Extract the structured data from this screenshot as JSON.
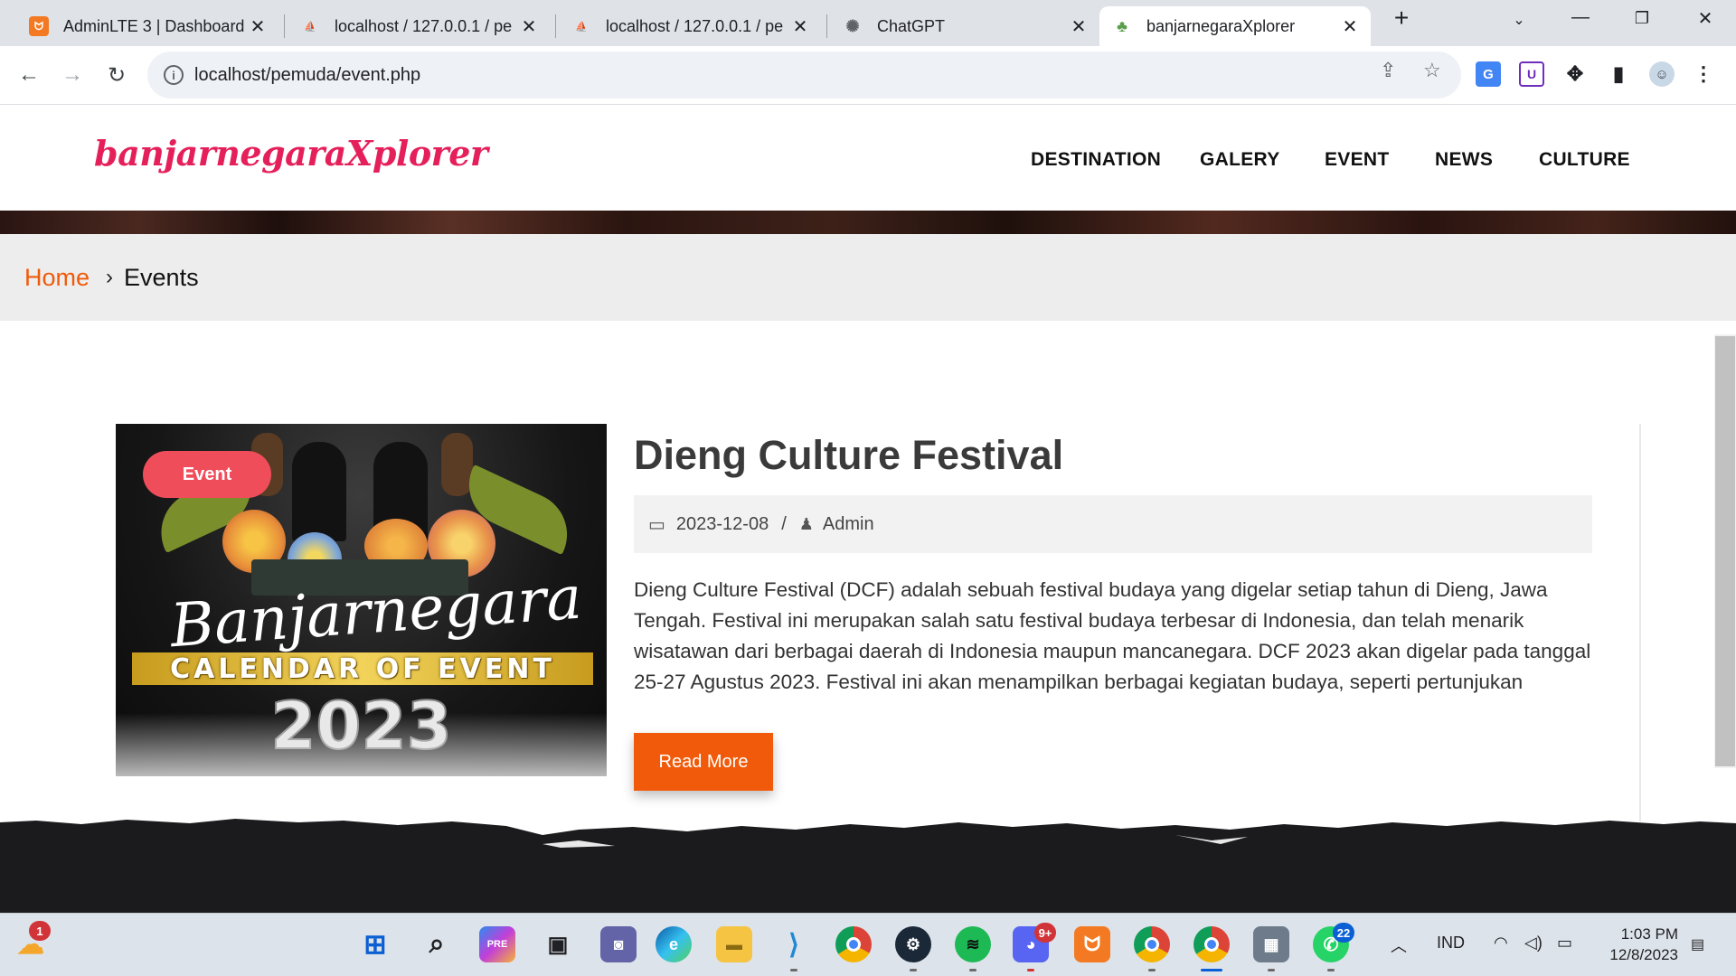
{
  "browser": {
    "tabs": [
      {
        "title": "AdminLTE 3 | Dashboard",
        "icon": "xampp-icon",
        "active": false
      },
      {
        "title": "localhost / 127.0.0.1 / pe",
        "icon": "phpmyadmin-icon",
        "active": false
      },
      {
        "title": "localhost / 127.0.0.1 / pe",
        "icon": "phpmyadmin-icon",
        "active": false
      },
      {
        "title": "ChatGPT",
        "icon": "chatgpt-icon",
        "active": false
      },
      {
        "title": "banjarnegaraXplorer",
        "icon": "palm-tree-icon",
        "active": true
      }
    ],
    "url": "localhost/pemuda/event.php"
  },
  "site": {
    "logo": "banjarnegaraXplorer",
    "menu": [
      "DESTINATION",
      "GALERY",
      "EVENT",
      "NEWS",
      "CULTURE"
    ]
  },
  "breadcrumb": {
    "home": "Home",
    "separator": "›",
    "current": "Events"
  },
  "event": {
    "badge": "Event",
    "image_script": "Banjarnegara",
    "image_band": "CALENDAR OF EVENT",
    "image_year": "2023",
    "title": "Dieng Culture Festival",
    "date": "2023-12-08",
    "meta_separator": "/",
    "author": "Admin",
    "description": "Dieng Culture Festival (DCF) adalah sebuah festival budaya yang digelar setiap tahun di Dieng, Jawa Tengah. Festival ini merupakan salah satu festival budaya terbesar di Indonesia, dan telah menarik wisatawan dari berbagai daerah di Indonesia maupun mancanegara. DCF 2023 akan digelar pada tanggal 25-27 Agustus 2023. Festival ini akan menampilkan berbagai kegiatan budaya, seperti pertunjukan",
    "read_more": "Read More"
  },
  "taskbar": {
    "weather_badge": "1",
    "discord_badge": "9+",
    "whatsapp_badge": "22",
    "language": "IND",
    "time": "1:03 PM",
    "date": "12/8/2023"
  },
  "colors": {
    "accent_orange": "#f05a0a",
    "logo_pink": "#e51f5a",
    "badge_red": "#f04d5a"
  }
}
